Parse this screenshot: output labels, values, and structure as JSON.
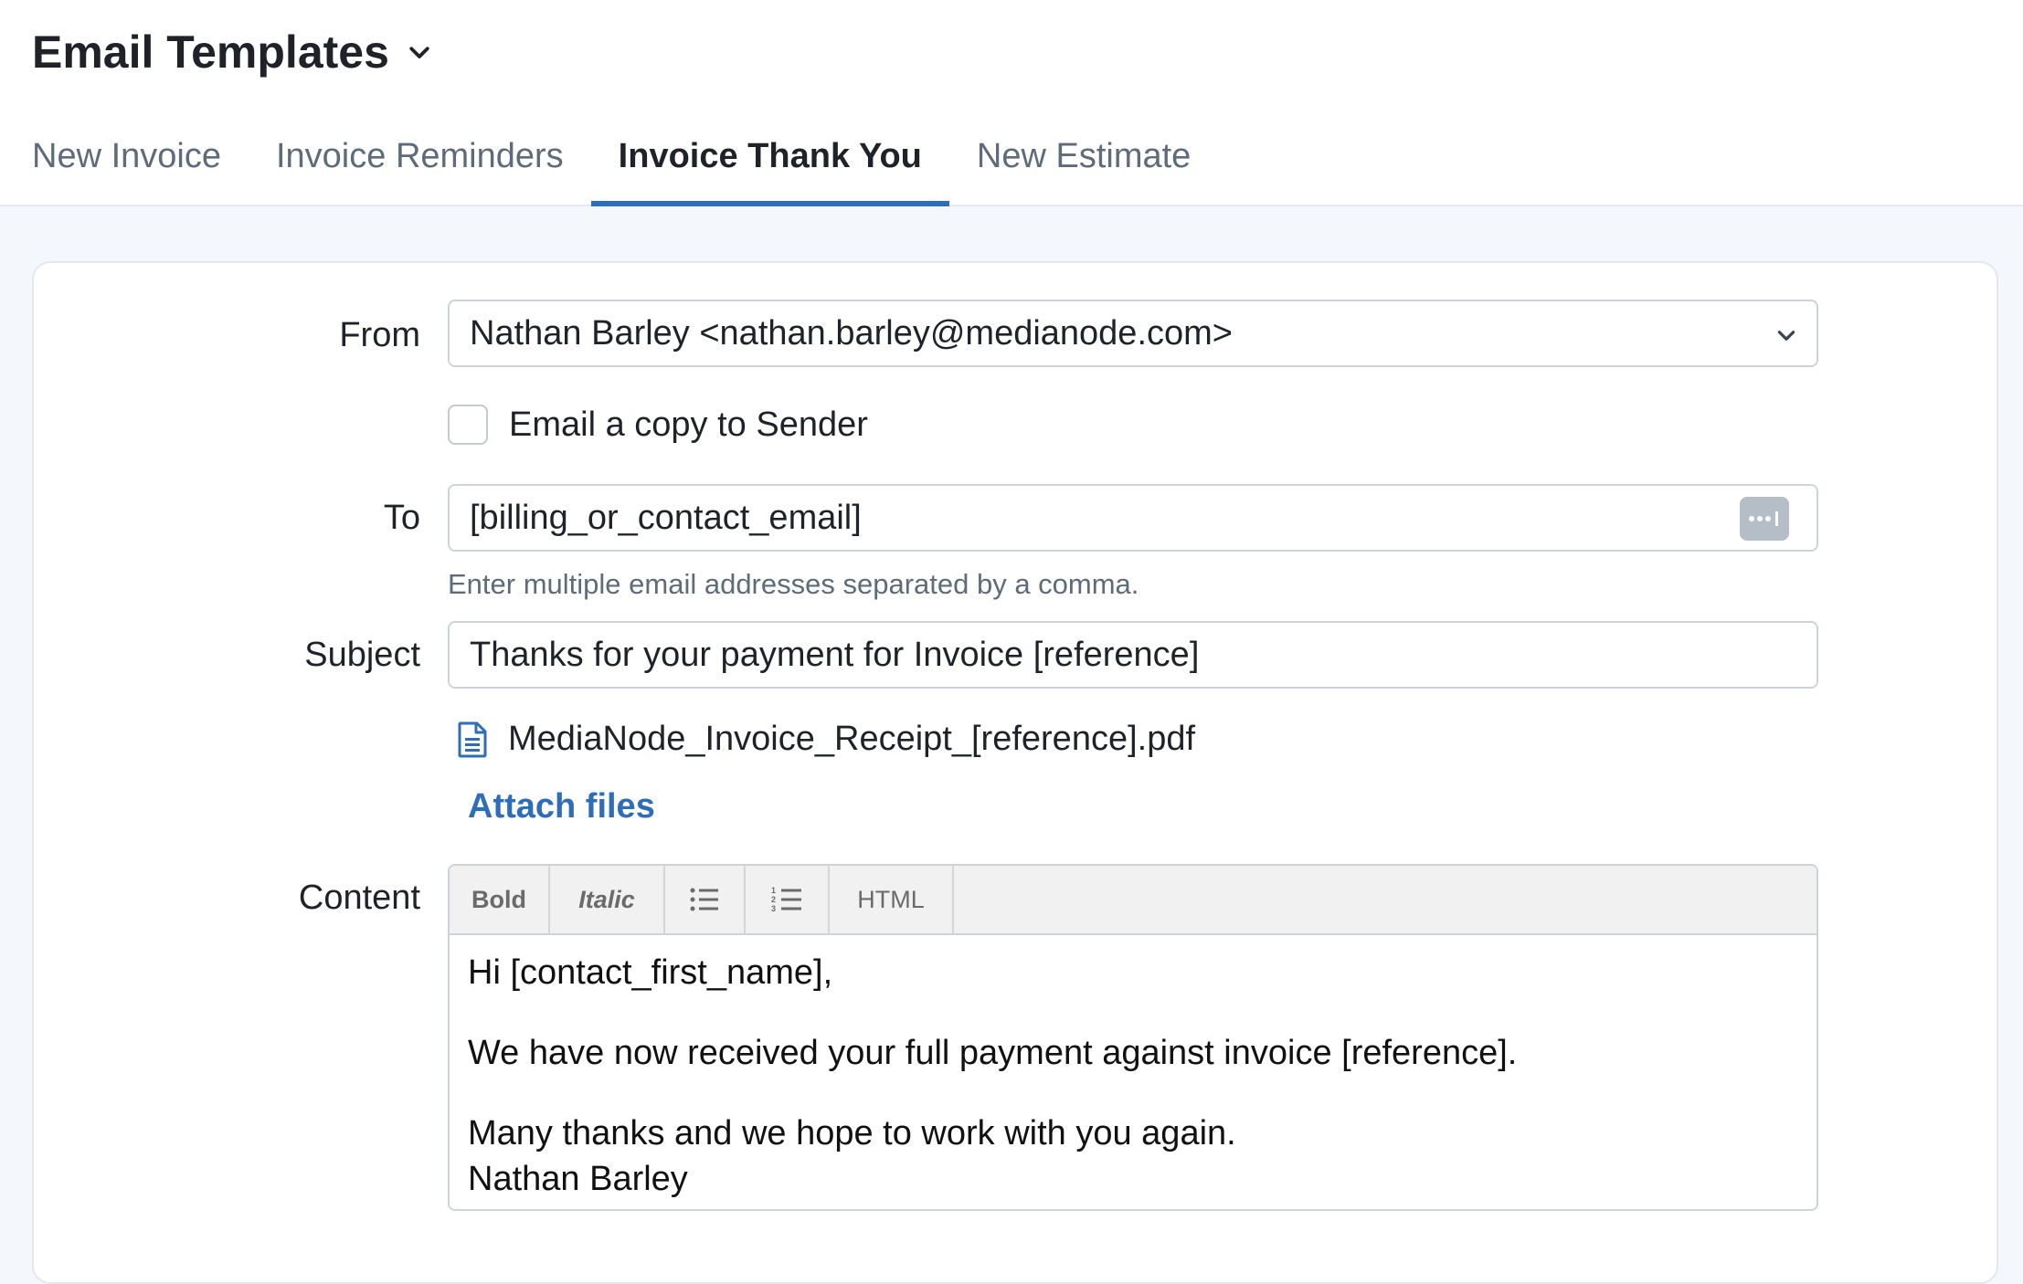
{
  "header": {
    "title": "Email Templates"
  },
  "tabs": [
    {
      "label": "New Invoice",
      "active": false
    },
    {
      "label": "Invoice Reminders",
      "active": false
    },
    {
      "label": "Invoice Thank You",
      "active": true
    },
    {
      "label": "New Estimate",
      "active": false
    }
  ],
  "form": {
    "from_label": "From",
    "from_value": "Nathan Barley <nathan.barley@medianode.com>",
    "copy_label": "Email a copy to Sender",
    "copy_checked": false,
    "to_label": "To",
    "to_value": "[billing_or_contact_email]",
    "to_help": "Enter multiple email addresses separated by a comma.",
    "subject_label": "Subject",
    "subject_value": "Thanks for your payment for Invoice [reference]",
    "attachment_name": "MediaNode_Invoice_Receipt_[reference].pdf",
    "attach_link": "Attach files",
    "content_label": "Content"
  },
  "editor": {
    "toolbar": {
      "bold": "Bold",
      "italic": "Italic",
      "html": "HTML"
    },
    "lines": {
      "greeting": "Hi [contact_first_name],",
      "body": "We have now received your full payment against invoice [reference].",
      "closing": "Many thanks and we hope to work with you again.",
      "signature": "Nathan Barley"
    }
  },
  "colors": {
    "accent": "#2e6db8",
    "page_bg": "#f4f7fb",
    "border": "#cdd3da"
  }
}
